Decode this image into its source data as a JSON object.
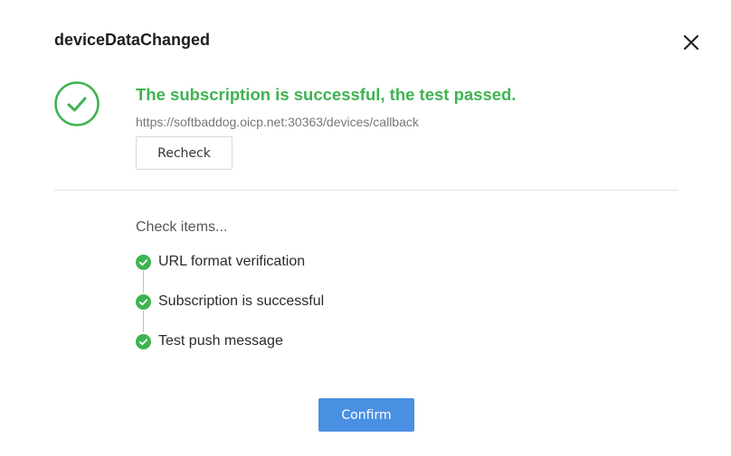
{
  "dialog": {
    "title": "deviceDataChanged",
    "close_icon": "close-icon"
  },
  "status": {
    "icon": "success-check-circle-icon",
    "message": "The subscription is successful, the test passed.",
    "url": "https://softbaddog.oicp.net:30363/devices/callback",
    "recheck_label": "Recheck",
    "color": "#3fb352"
  },
  "checks": {
    "header": "Check items...",
    "items": [
      {
        "label": "URL format verification",
        "status": "passed",
        "icon": "check-circle-icon"
      },
      {
        "label": "Subscription is successful",
        "status": "passed",
        "icon": "check-circle-icon"
      },
      {
        "label": "Test push message",
        "status": "passed",
        "icon": "check-circle-icon"
      }
    ]
  },
  "footer": {
    "confirm_label": "Confirm",
    "accent_color": "#4a90e2"
  }
}
